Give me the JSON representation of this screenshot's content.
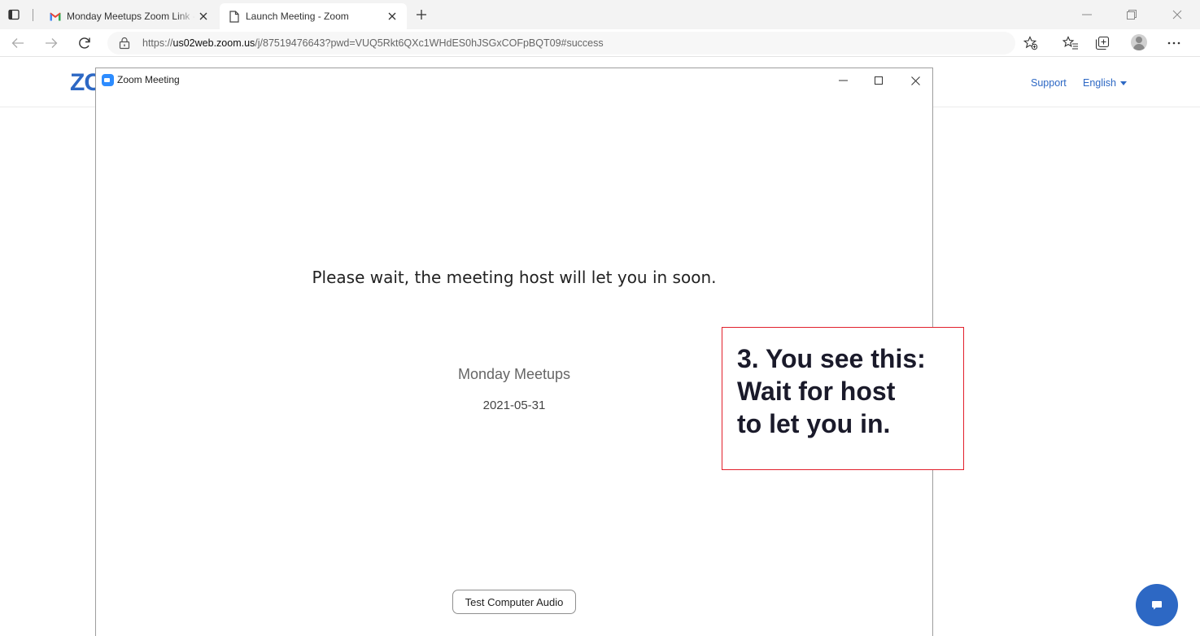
{
  "browser": {
    "tabs": [
      {
        "label": "Monday Meetups Zoom Link - c",
        "icon": "gmail-icon",
        "active": false
      },
      {
        "label": "Launch Meeting - Zoom",
        "icon": "page-icon",
        "active": true
      }
    ],
    "address_bar": {
      "url_prefix": "https://",
      "url_host": "us02web.zoom.us",
      "url_path": "/j/87519476643?pwd=VUQ5Rkt6QXc1WHdES0hJSGxCOFpBQT09#success"
    }
  },
  "page": {
    "logo_text": "ZC",
    "nav": {
      "support_label": "Support",
      "language_label": "English"
    }
  },
  "zoom_window": {
    "title": "Zoom Meeting",
    "wait_message": "Please wait, the meeting host will let you in soon.",
    "meeting_name": "Monday Meetups",
    "meeting_date": "2021-05-31",
    "test_audio_label": "Test Computer Audio"
  },
  "callout": {
    "text": "3. You see this:\nWait for host\nto let you in.",
    "border_color": "#e2202c"
  },
  "colors": {
    "zoom_blue": "#2d68c4",
    "zoom_icon_blue": "#2d8cff",
    "gmail_red": "#ea4335"
  }
}
